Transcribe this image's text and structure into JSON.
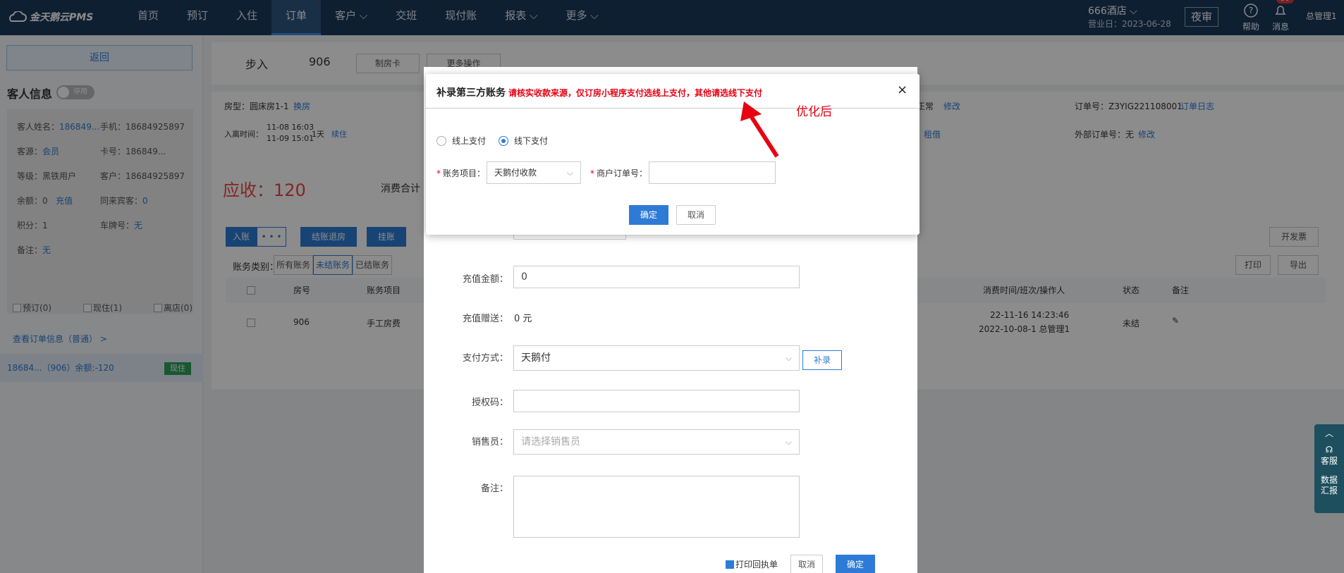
{
  "topbar": {
    "logo": "金天鹅云PMS",
    "nav": [
      "首页",
      "预订",
      "入住",
      "订单",
      "客户",
      "交班",
      "现付账",
      "报表",
      "更多"
    ],
    "hotel": "666酒店",
    "biz_date": "营业日：2023-06-28",
    "night_audit": "夜审",
    "help": "帮助",
    "messages": "消息",
    "badge": "90",
    "user": "总管理1"
  },
  "sidebar": {
    "back": "返回",
    "customer_info_title": "客人信息",
    "toggle": "停用",
    "name_label": "客人姓名：",
    "name": "186849...",
    "phone_label": "手机：",
    "phone": "18684925897",
    "source_label": "客源：",
    "source": "会员",
    "card_label": "卡号：",
    "card": "186849...",
    "level_label": "等级：",
    "level": "黑铁用户",
    "customer_label": "客户：",
    "customer": "18684925897",
    "balance_label": "余额：",
    "balance": "0",
    "recharge": "充值",
    "companion_label": "同来宾客：",
    "companion": "0",
    "points_label": "积分：",
    "points": "1",
    "plate_label": "车牌号：",
    "plate": "无",
    "remark_label": "备注：",
    "remark": "无",
    "checks": [
      "预订(0)",
      "现住(1)",
      "离店(0)"
    ],
    "view_order": "查看订单信息（普通）  >",
    "room_item": "18684...（906）余额:-120",
    "room_status": "现住"
  },
  "main": {
    "title": "步入",
    "room": "906",
    "make_card": "制房卡",
    "more_ops": "更多操作",
    "room_type": "房型：圆床房1-1",
    "change_room": "换房",
    "checkin_label": "入离时间：",
    "checkin": "11-08 16:03",
    "checkout": "11-09 15:01",
    "days": "1天",
    "extend": "续住",
    "receivable": "应收：120",
    "consume_total": "消费合计",
    "normal": "正常",
    "modify": "修改",
    "order_no": "订单号：Z3YIG221108001",
    "order_log": "订单日志",
    "ext_order": "外部订单号：无",
    "rent": "租借",
    "actions": [
      "入账",
      "结账退房",
      "挂账"
    ],
    "ellipsis": "• • •",
    "invoice": "开发票",
    "print": "打印",
    "export": "导出",
    "account_type_label": "账务类别：",
    "account_types": [
      "所有账务",
      "未结账务",
      "已结账务"
    ],
    "table_headers": [
      "房号",
      "账务项目",
      "消费时间/班次/操作人",
      "状态",
      "备注"
    ],
    "row": {
      "room": "906",
      "item": "手工房费",
      "time": "22-11-16 14:23:46",
      "shift": "2022-10-08-1 总管理1",
      "status": "未结"
    }
  },
  "bg_dialog": {
    "recharge_amount_label": "充值金额：",
    "recharge_amount": "0",
    "bonus_label": "充值赠送：",
    "bonus": "0 元",
    "pay_label": "支付方式：",
    "pay": "天鹅付",
    "supplement": "补录",
    "auth_label": "授权码：",
    "sales_label": "销售员：",
    "sales_placeholder": "请选择销售员",
    "remark_label": "备注：",
    "print_receipt": "打印回执单",
    "cancel": "取消",
    "confirm": "确定"
  },
  "modal": {
    "title": "补录第三方账务",
    "warning": "请核实收款来源，仅订房小程序支付选线上支付，其他请选线下支付",
    "close": "×",
    "online": "线上支付",
    "offline": "线下支付",
    "item_label": "账务项目：",
    "item_value": "天鹅付收款",
    "merchant_label": "商户订单号：",
    "merchant_value": "",
    "confirm": "确定",
    "cancel": "取消"
  },
  "annotation": "优化后",
  "side_widget": {
    "service": "客服",
    "data": "数据汇报"
  },
  "colors": {
    "topbar": "#1d3a5c",
    "primary": "#2d7bd6",
    "warning": "#e60012"
  }
}
